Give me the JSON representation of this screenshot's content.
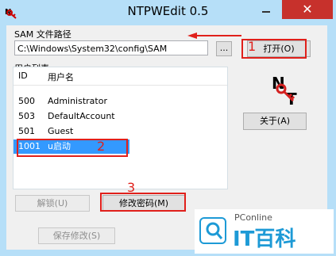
{
  "window": {
    "title": "NTPWEdit 0.5",
    "close_glyph": "✕",
    "accent": "#b6dff8",
    "close_color": "#c7312c"
  },
  "sam": {
    "label": "SAM 文件路径",
    "path": "C:\\Windows\\System32\\config\\SAM",
    "browse_label": "...",
    "open_label": "打开(O)"
  },
  "users": {
    "label": "用户列表",
    "columns": [
      "ID",
      "用户名"
    ],
    "rows": [
      {
        "id": "500",
        "name": "Administrator"
      },
      {
        "id": "503",
        "name": "DefaultAccount"
      },
      {
        "id": "501",
        "name": "Guest"
      },
      {
        "id": "1001",
        "name": "u启动",
        "selected": true
      }
    ]
  },
  "buttons": {
    "about": "关于(A)",
    "unlock": "解锁(U)",
    "change_password": "修改密码(M)",
    "save": "保存修改(S)"
  },
  "annotations": {
    "n1": "1",
    "n2": "2",
    "n3": "3",
    "color": "#e0201b"
  },
  "watermark": {
    "brand": "PConline",
    "name": "IT百科"
  }
}
